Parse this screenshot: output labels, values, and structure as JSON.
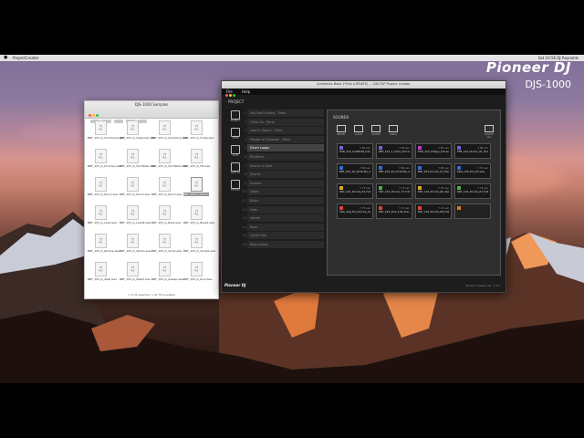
{
  "menubar": {
    "app_name": "ProjectCreator",
    "right_text": "Sat 10:56  DJ Reynolds"
  },
  "brand": {
    "logo": "Pioneer DJ",
    "model": "DJS-1000",
    "color": "#ffffff"
  },
  "finder": {
    "title": "DJS-1000 Samples",
    "status": "1 of 32 selected, 1.42 TB available",
    "files": [
      "BRT_103_G_DrumLoop.wav",
      "BRT_103_G_ClapLoop.wav",
      "BRT_103_G_Dumpling.wav",
      "BRT_103_G_Funky.wav",
      "BRT_103_G_DrumLp.wav",
      "BRT_103_G_ChrdStab.wav",
      "BRT_103_G_ChrdStb2.wav",
      "BRT_103_G_Fill.wav",
      "BRT_103_G_Perc1.wav",
      "BRT_103_G_Perc2.wav",
      "BRT_103_G_Perc3.wav",
      "BRT_103_G_Perc4.wav",
      "BRT_103_G_Lead.wav",
      "BRT_103_G_Lead2.wav",
      "BRT_103_G_Bass.wav",
      "BRT_103_G_Bass2.wav",
      "BRT_103_G_RmxLp.wav",
      "BRT_103_G_Atmos.wav",
      "BRT_103_G_Vocal.wav",
      "BRT_103_G_Vocal2.wav",
      "BRT_103_G_Stab.wav",
      "BRT_103_G_Stab2.wav",
      "BRT_103_G_Sweep.wav",
      "BRT_103_G_Kick.wav"
    ],
    "selected_index": 11
  },
  "app": {
    "title": "Architects Beat 1*Fish (UPDATE) — DJS-TSP Project Creator",
    "menus": [
      "File",
      "Help"
    ],
    "project_label": "PROJECT",
    "footer_logo": "Pioneer DJ",
    "version": "Project Creator Ver. 1.0.0",
    "sidebar": [
      {
        "icon": "project-icon",
        "caption": "PROJECT"
      },
      {
        "icon": "open-icon",
        "caption": "OPEN"
      },
      {
        "icon": "save-icon",
        "caption": "SAVE"
      },
      {
        "icon": "save-as-icon",
        "caption": "SAVE AS"
      },
      {
        "icon": "export-icon",
        "caption": "EXPORT"
      }
    ],
    "pages": [
      {
        "num": "1",
        "name": "You Don't Know - Parts"
      },
      {
        "num": "2",
        "name": "I Feel So - Parts"
      },
      {
        "num": "3",
        "name": "Lost In Space - Parts"
      },
      {
        "num": "4",
        "name": "Master of Disaster - Parts"
      },
      {
        "num": "5",
        "name": "Drum Loops",
        "active": true
      },
      {
        "num": "6",
        "name": "Rhythms"
      },
      {
        "num": "7",
        "name": "Drums & Hats"
      },
      {
        "num": "8",
        "name": "Drums"
      },
      {
        "num": "9",
        "name": "Snares"
      },
      {
        "num": "10",
        "name": "Claps"
      },
      {
        "num": "11",
        "name": "Kicks"
      },
      {
        "num": "12",
        "name": "Hats"
      },
      {
        "num": "13",
        "name": "Voices"
      },
      {
        "num": "14",
        "name": "Bass"
      },
      {
        "num": "15",
        "name": "Synth Hits"
      },
      {
        "num": "16",
        "name": "Bass Loops"
      }
    ],
    "panel": {
      "title": "SOUNDS",
      "tools": [
        {
          "icon": "import-icon",
          "caption": "IMPORT"
        },
        {
          "icon": "clear-icon",
          "caption": "CLEAR"
        },
        {
          "icon": "delete-icon",
          "caption": "DELETE"
        },
        {
          "icon": "undo-icon",
          "caption": "UNDO"
        },
        {
          "icon": "trash-icon",
          "caption": "DELETE ALL"
        }
      ],
      "pads": [
        {
          "name": "DSR_123_AntiMidst_Full.wav",
          "dur": "7.80 sec",
          "color": "#7b5cd6"
        },
        {
          "name": "BRT_123_3_Chilln_Full.wav",
          "dur": "7.80 sec",
          "color": "#7b5cd6"
        },
        {
          "name": "DSR_123_Chippy_Full.wav",
          "dur": "7.80 sec",
          "color": "#b43ec2"
        },
        {
          "name": "FRE_122_Drums_01_Full.wav",
          "dur": "7.80 sec",
          "color": "#7b5cd6"
        },
        {
          "name": "BRT_103_10_ChillnTop_4.wav",
          "dur": "7.80 sec",
          "color": "#2d6fd8"
        },
        {
          "name": "BRT_103_10_ChillnTop_4.wav",
          "dur": "7.80 sec",
          "color": "#2d6fd8"
        },
        {
          "name": "BRT_103_Drums_07_Full_4.wav",
          "dur": "7.80 sec",
          "color": "#2d6fd8"
        },
        {
          "name": "SKG_124_Full_01.wav",
          "dur": "7.74 sec",
          "color": "#2d6fd8"
        },
        {
          "name": "DRY_122_Drums_03_Full_4.wav",
          "dur": "7.74 sec",
          "color": "#d7a92a"
        },
        {
          "name": "DRY_122_Drums_77_Full_4.wav",
          "dur": "7.74 sec",
          "color": "#4ab04a"
        },
        {
          "name": "DRY_122_Drums_06_Toplopp.wav",
          "dur": "7.74 sec",
          "color": "#d7a92a"
        },
        {
          "name": "DRY_122_Drums_07_Full_4.wav",
          "dur": "7.74 sec",
          "color": "#4ab04a"
        },
        {
          "name": "SKG_120_Full_Drums_11.wav",
          "dur": "7.74 sec",
          "color": "#e04040"
        },
        {
          "name": "DRY_122_Kick_104_Full.wav",
          "dur": "7.74 sec",
          "color": "#e04040"
        },
        {
          "name": "DRY_122_Drums_08_Full_4.wav",
          "dur": "7.74 sec",
          "color": "#e04040"
        },
        {
          "name": "",
          "dur": "",
          "color": "#e07a20",
          "empty": true
        }
      ]
    }
  }
}
